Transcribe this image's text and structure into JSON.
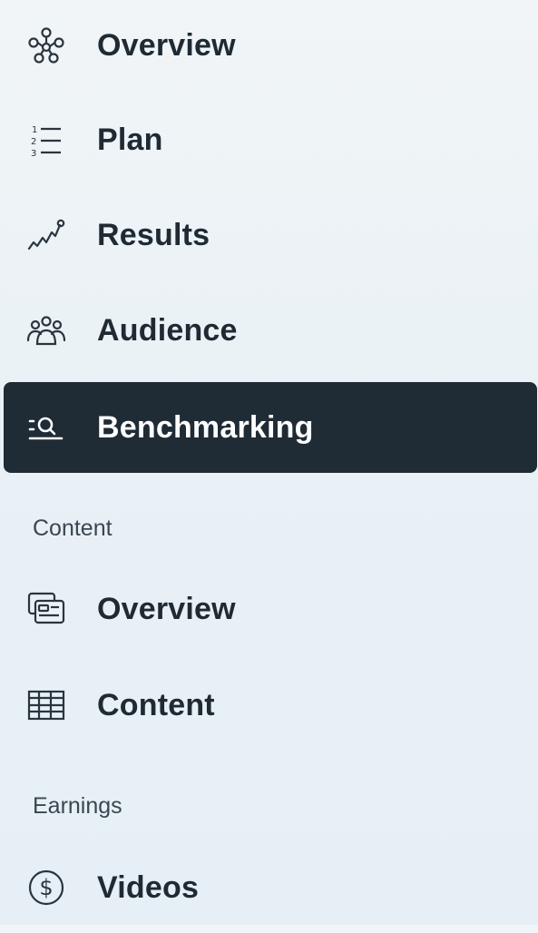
{
  "nav": {
    "items": [
      {
        "label": "Overview",
        "icon": "network-nodes-icon",
        "active": false
      },
      {
        "label": "Plan",
        "icon": "numbered-list-icon",
        "active": false
      },
      {
        "label": "Results",
        "icon": "trend-line-icon",
        "active": false
      },
      {
        "label": "Audience",
        "icon": "people-group-icon",
        "active": false
      },
      {
        "label": "Benchmarking",
        "icon": "benchmark-search-icon",
        "active": true
      }
    ],
    "content_section": {
      "heading": "Content",
      "items": [
        {
          "label": "Overview",
          "icon": "content-cards-icon"
        },
        {
          "label": "Content",
          "icon": "table-grid-icon"
        }
      ]
    },
    "earnings_section": {
      "heading": "Earnings",
      "items": [
        {
          "label": "Videos",
          "icon": "dollar-circle-icon"
        }
      ]
    }
  },
  "colors": {
    "active_background": "#1f2b35",
    "active_text": "#ffffff",
    "text": "#1f2a33",
    "page_background": "#eaf2f7"
  }
}
